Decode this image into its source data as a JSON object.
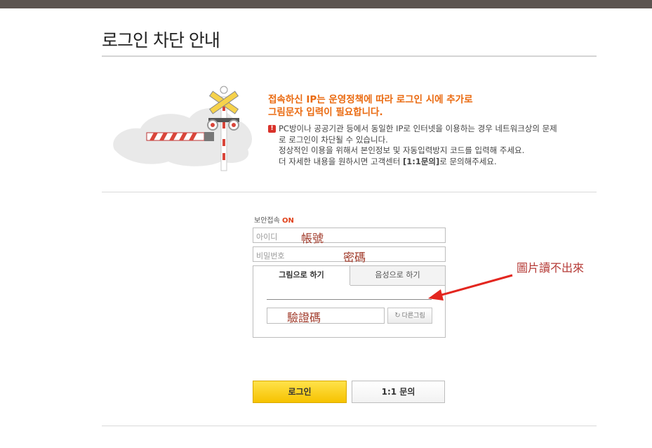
{
  "page": {
    "title": "로그인 차단 안내"
  },
  "notice": {
    "headline_1": "접속하신 IP는 운영정책에 따라 로그인 시에 추가로",
    "headline_2": "그림문자 입력이 필요합니다.",
    "line_1": "PC방이나 공공기관 등에서 동일한 IP로 인터넷을 이용하는 경우 네트워크상의 문제",
    "line_2": "로 로그인이 차단될 수 있습니다.",
    "line_3": "정상적인 이용을 위해서 본인정보 및 자동입력방지 코드를 입력해 주세요.",
    "line_4_pre": "더 자세한 내용을 원하시면 고객센터 ",
    "line_4_link": "[1:1문의]",
    "line_4_post": "로 문의해주세요.",
    "warn_icon": "exclamation-icon"
  },
  "secure": {
    "label": "보안접속",
    "status": "ON"
  },
  "login_form": {
    "id_placeholder": "아이디",
    "id_annotation": "帳號",
    "pw_placeholder": "비밀번호",
    "pw_annotation": "密碼"
  },
  "captcha": {
    "tab_image": "그림으로 하기",
    "tab_audio": "음성으로 하기",
    "input_annotation": "驗證碼",
    "refresh_label": "다른그림"
  },
  "annotation": {
    "text": "圖片讀不出來",
    "color": "#e3261f"
  },
  "buttons": {
    "login": "로그인",
    "inquiry": "1:1 문의"
  },
  "colors": {
    "accent_orange": "#ea6a10",
    "login_yellow": "#f6c200",
    "on_red": "#e0421b"
  }
}
